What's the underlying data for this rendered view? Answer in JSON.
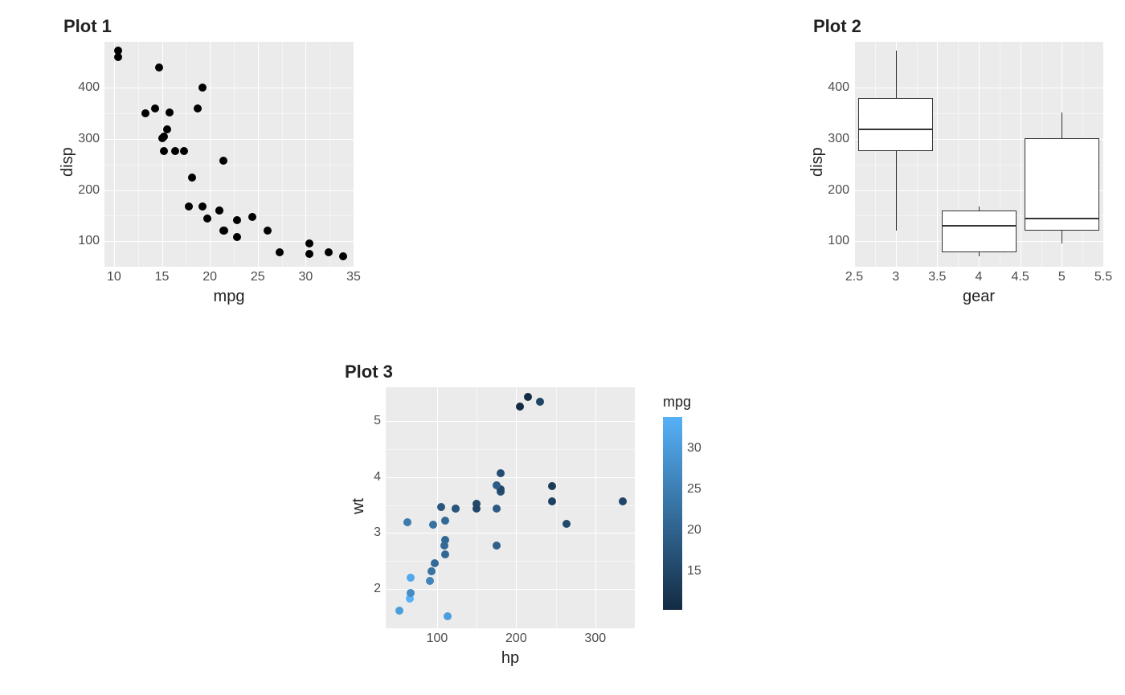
{
  "chart_data": [
    {
      "type": "scatter",
      "title": "Plot 1",
      "xlabel": "mpg",
      "ylabel": "disp",
      "xlim": [
        9,
        35
      ],
      "ylim": [
        50,
        490
      ],
      "xticks": [
        10,
        15,
        20,
        25,
        30,
        35
      ],
      "yticks": [
        100,
        200,
        300,
        400
      ],
      "points": [
        {
          "x": 21.0,
          "y": 160.0
        },
        {
          "x": 21.0,
          "y": 160.0
        },
        {
          "x": 22.8,
          "y": 108.0
        },
        {
          "x": 21.4,
          "y": 258.0
        },
        {
          "x": 18.7,
          "y": 360.0
        },
        {
          "x": 18.1,
          "y": 225.0
        },
        {
          "x": 14.3,
          "y": 360.0
        },
        {
          "x": 24.4,
          "y": 146.7
        },
        {
          "x": 22.8,
          "y": 140.8
        },
        {
          "x": 19.2,
          "y": 167.6
        },
        {
          "x": 17.8,
          "y": 167.6
        },
        {
          "x": 16.4,
          "y": 275.8
        },
        {
          "x": 17.3,
          "y": 275.8
        },
        {
          "x": 15.2,
          "y": 275.8
        },
        {
          "x": 10.4,
          "y": 472.0
        },
        {
          "x": 10.4,
          "y": 460.0
        },
        {
          "x": 14.7,
          "y": 440.0
        },
        {
          "x": 32.4,
          "y": 78.7
        },
        {
          "x": 30.4,
          "y": 75.7
        },
        {
          "x": 33.9,
          "y": 71.1
        },
        {
          "x": 21.5,
          "y": 120.1
        },
        {
          "x": 15.5,
          "y": 318.0
        },
        {
          "x": 15.2,
          "y": 304.0
        },
        {
          "x": 13.3,
          "y": 350.0
        },
        {
          "x": 19.2,
          "y": 400.0
        },
        {
          "x": 27.3,
          "y": 79.0
        },
        {
          "x": 26.0,
          "y": 120.3
        },
        {
          "x": 30.4,
          "y": 95.1
        },
        {
          "x": 15.8,
          "y": 351.0
        },
        {
          "x": 19.7,
          "y": 145.0
        },
        {
          "x": 15.0,
          "y": 301.0
        },
        {
          "x": 21.4,
          "y": 121.0
        }
      ]
    },
    {
      "type": "boxplot",
      "title": "Plot 2",
      "xlabel": "gear",
      "ylabel": "disp",
      "xlim": [
        2.5,
        5.5
      ],
      "ylim": [
        50,
        490
      ],
      "xticks": [
        2.5,
        3.0,
        3.5,
        4.0,
        4.5,
        5.0,
        5.5
      ],
      "yticks": [
        100,
        200,
        300,
        400
      ],
      "boxes": [
        {
          "x": 3,
          "min": 120.1,
          "q1": 275.8,
          "median": 318.0,
          "q3": 380.0,
          "max": 472.0
        },
        {
          "x": 4,
          "min": 71.1,
          "q1": 78.85,
          "median": 130.9,
          "q3": 160.0,
          "max": 167.6
        },
        {
          "x": 5,
          "min": 95.1,
          "q1": 120.3,
          "median": 145.0,
          "q3": 301.0,
          "max": 351.0
        }
      ]
    },
    {
      "type": "scatter",
      "title": "Plot 3",
      "xlabel": "hp",
      "ylabel": "wt",
      "colorlabel": "mpg",
      "xlim": [
        35,
        350
      ],
      "ylim": [
        1.3,
        5.6
      ],
      "xticks": [
        100,
        200,
        300
      ],
      "yticks": [
        2,
        3,
        4,
        5
      ],
      "color_scale": {
        "min": 10.4,
        "max": 33.9,
        "low": "#132b43",
        "high": "#56b1f7"
      },
      "legend_ticks": [
        15,
        20,
        25,
        30
      ],
      "points": [
        {
          "x": 110,
          "y": 2.62,
          "c": 21.0
        },
        {
          "x": 110,
          "y": 2.875,
          "c": 21.0
        },
        {
          "x": 93,
          "y": 2.32,
          "c": 22.8
        },
        {
          "x": 110,
          "y": 3.215,
          "c": 21.4
        },
        {
          "x": 175,
          "y": 3.44,
          "c": 18.7
        },
        {
          "x": 105,
          "y": 3.46,
          "c": 18.1
        },
        {
          "x": 245,
          "y": 3.57,
          "c": 14.3
        },
        {
          "x": 62,
          "y": 3.19,
          "c": 24.4
        },
        {
          "x": 95,
          "y": 3.15,
          "c": 22.8
        },
        {
          "x": 123,
          "y": 3.44,
          "c": 19.2
        },
        {
          "x": 123,
          "y": 3.44,
          "c": 17.8
        },
        {
          "x": 180,
          "y": 4.07,
          "c": 16.4
        },
        {
          "x": 180,
          "y": 3.73,
          "c": 17.3
        },
        {
          "x": 180,
          "y": 3.78,
          "c": 15.2
        },
        {
          "x": 205,
          "y": 5.25,
          "c": 10.4
        },
        {
          "x": 215,
          "y": 5.424,
          "c": 10.4
        },
        {
          "x": 230,
          "y": 5.345,
          "c": 14.7
        },
        {
          "x": 66,
          "y": 2.2,
          "c": 32.4
        },
        {
          "x": 52,
          "y": 1.615,
          "c": 30.4
        },
        {
          "x": 65,
          "y": 1.835,
          "c": 33.9
        },
        {
          "x": 97,
          "y": 2.465,
          "c": 21.5
        },
        {
          "x": 150,
          "y": 3.52,
          "c": 15.5
        },
        {
          "x": 150,
          "y": 3.435,
          "c": 15.2
        },
        {
          "x": 245,
          "y": 3.84,
          "c": 13.3
        },
        {
          "x": 175,
          "y": 3.845,
          "c": 19.2
        },
        {
          "x": 66,
          "y": 1.935,
          "c": 27.3
        },
        {
          "x": 91,
          "y": 2.14,
          "c": 26.0
        },
        {
          "x": 113,
          "y": 1.513,
          "c": 30.4
        },
        {
          "x": 264,
          "y": 3.17,
          "c": 15.8
        },
        {
          "x": 175,
          "y": 2.77,
          "c": 19.7
        },
        {
          "x": 335,
          "y": 3.57,
          "c": 15.0
        },
        {
          "x": 109,
          "y": 2.78,
          "c": 21.4
        }
      ]
    }
  ]
}
